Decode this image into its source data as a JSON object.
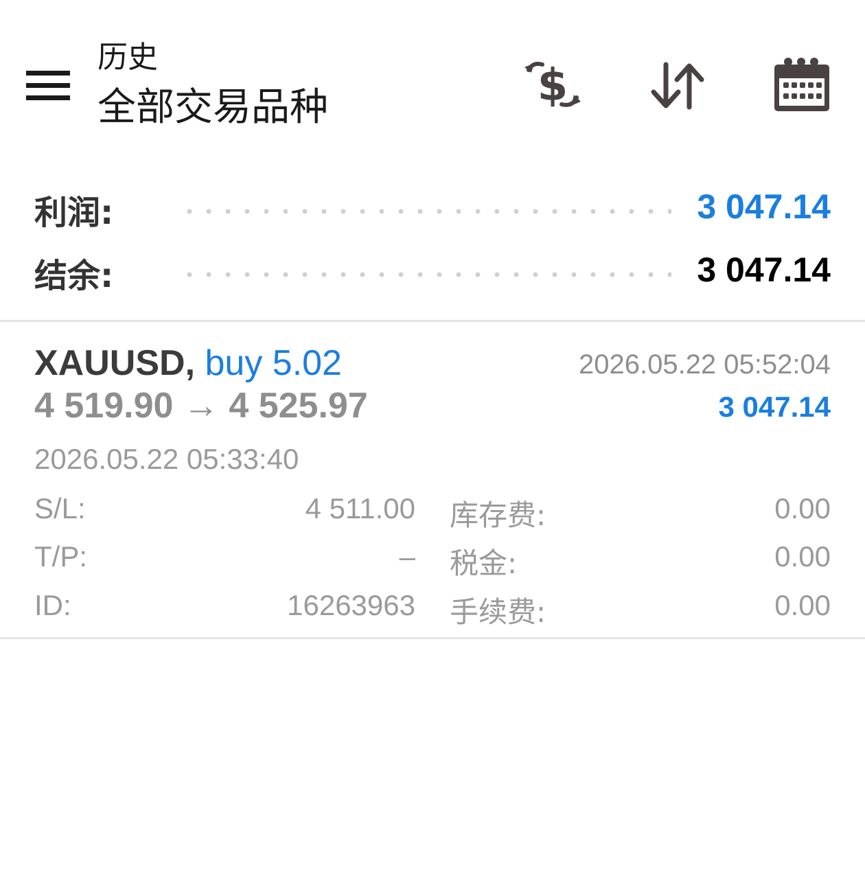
{
  "header": {
    "title": "历史",
    "subtitle": "全部交易品种",
    "icons": {
      "menu": "hamburger-menu-icon",
      "currency": "currency-exchange-icon",
      "sort": "sort-icon",
      "calendar": "calendar-icon"
    }
  },
  "summary": {
    "profit_label": "利润:",
    "profit_value": "3 047.14",
    "balance_label": "结余:",
    "balance_value": "3 047.14"
  },
  "trade": {
    "symbol": "XAUUSD,",
    "type": "buy 5.02",
    "open_price": "4 519.90",
    "arrow": "→",
    "close_price": "4 525.97",
    "close_time": "2026.05.22 05:52:04",
    "profit": "3 047.14",
    "open_time": "2026.05.22 05:33:40",
    "details": {
      "sl_label": "S/L:",
      "sl_value": "4 511.00",
      "tp_label": "T/P:",
      "tp_value": "–",
      "id_label": "ID:",
      "id_value": "16263963",
      "swap_label": "库存费:",
      "swap_value": "0.00",
      "tax_label": "税金:",
      "tax_value": "0.00",
      "commission_label": "手续费:",
      "commission_value": "0.00"
    }
  },
  "colors": {
    "accent_blue": "#1a7ee0",
    "icon_dark": "#4a4242",
    "text_gray": "#9a9a9a"
  }
}
